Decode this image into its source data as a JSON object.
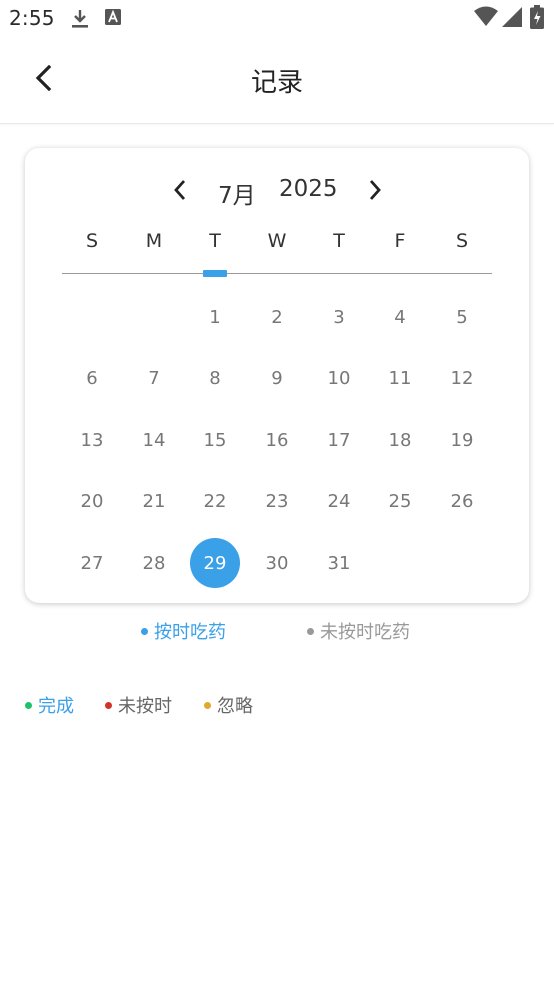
{
  "status_bar": {
    "time": "2:55",
    "icons": [
      "download-icon",
      "app-notification-icon",
      "wifi-icon",
      "signal-icon",
      "battery-charging-icon"
    ]
  },
  "header": {
    "title": "记录",
    "back_icon": "chevron-left-icon"
  },
  "calendar": {
    "month": "7月",
    "year": "2025",
    "prev_icon": "chevron-left-icon",
    "next_icon": "chevron-right-icon",
    "weekdays": [
      "S",
      "M",
      "T",
      "W",
      "T",
      "F",
      "S"
    ],
    "selected_day": "29",
    "weeks": [
      [
        "",
        "",
        "1",
        "2",
        "3",
        "4",
        "5"
      ],
      [
        "6",
        "7",
        "8",
        "9",
        "10",
        "11",
        "12"
      ],
      [
        "13",
        "14",
        "15",
        "16",
        "17",
        "18",
        "19"
      ],
      [
        "20",
        "21",
        "22",
        "23",
        "24",
        "25",
        "26"
      ],
      [
        "27",
        "28",
        "29",
        "30",
        "31",
        "",
        ""
      ]
    ]
  },
  "filter_legend": [
    {
      "label": "按时吃药",
      "color": "#3aa0e8"
    },
    {
      "label": "未按时吃药",
      "color": "#999999"
    }
  ],
  "status_legend": [
    {
      "label": "完成",
      "dot_color": "#1fc26b",
      "text_color": "#3aa0e8"
    },
    {
      "label": "未按时",
      "dot_color": "#d0342c",
      "text_color": "#666666"
    },
    {
      "label": "忽略",
      "dot_color": "#e0a82e",
      "text_color": "#666666"
    }
  ],
  "colors": {
    "accent": "#3aa0e8"
  }
}
